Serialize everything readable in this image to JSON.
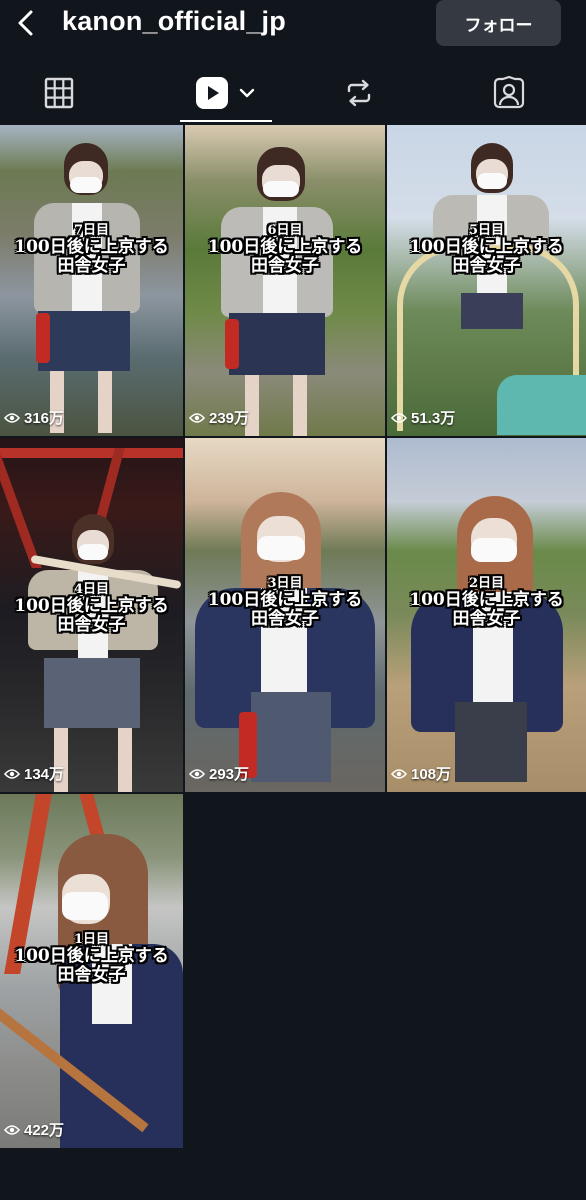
{
  "header": {
    "title": "kanon_official_jp",
    "follow_label": "フォロー"
  },
  "tabs": [
    {
      "name": "grid",
      "icon": "grid-icon"
    },
    {
      "name": "reels",
      "icon": "reels-play-icon",
      "active": true,
      "has_dropdown": true
    },
    {
      "name": "reposts",
      "icon": "repost-icon"
    },
    {
      "name": "tagged",
      "icon": "tagged-person-icon"
    }
  ],
  "videos": [
    {
      "day": "7日目",
      "caption_line1": "100日後に上京する",
      "caption_line2": "田舎女子",
      "views": "316万"
    },
    {
      "day": "6日目",
      "caption_line1": "100日後に上京する",
      "caption_line2": "田舎女子",
      "views": "239万"
    },
    {
      "day": "5日目",
      "caption_line1": "100日後に上京する",
      "caption_line2": "田舎女子",
      "views": "51.3万"
    },
    {
      "day": "4日目",
      "caption_line1": "100日後に上京する",
      "caption_line2": "田舎女子",
      "views": "134万"
    },
    {
      "day": "3日目",
      "caption_line1": "100日後に上京する",
      "caption_line2": "田舎女子",
      "views": "293万"
    },
    {
      "day": "2日目",
      "caption_line1": "100日後に上京する",
      "caption_line2": "田舎女子",
      "views": "108万"
    },
    {
      "day": "1日目",
      "caption_line1": "100日後に上京する",
      "caption_line2": "田舎女子",
      "views": "422万"
    }
  ],
  "colors": {
    "background": "#11151c",
    "follow_button": "#353a42",
    "text": "#ffffff"
  }
}
